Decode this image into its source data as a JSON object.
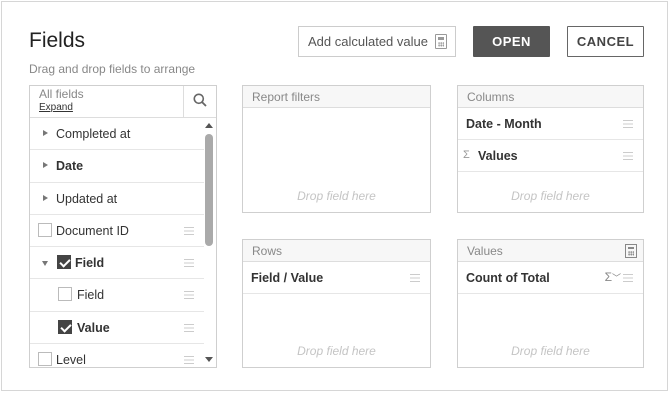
{
  "dialog": {
    "title": "Fields",
    "subtitle": "Drag and drop fields to arrange",
    "add_calculated_label": "Add calculated value",
    "open_label": "OPEN",
    "cancel_label": "CANCEL"
  },
  "all_fields": {
    "header": "All fields",
    "expand_label": "Expand",
    "items": [
      {
        "label": "Completed at",
        "control": "expand-arrow",
        "checked": false
      },
      {
        "label": "Date",
        "control": "expand-arrow",
        "checked": false
      },
      {
        "label": "Updated at",
        "control": "expand-arrow",
        "checked": false
      },
      {
        "label": "Document ID",
        "control": "checkbox",
        "checked": false
      },
      {
        "label": "Field",
        "control": "checkbox",
        "checked": true,
        "expanded": true
      },
      {
        "label": "Field",
        "control": "checkbox",
        "checked": false,
        "child": true
      },
      {
        "label": "Value",
        "control": "checkbox",
        "checked": true,
        "child": true
      },
      {
        "label": "Level",
        "control": "checkbox",
        "checked": false
      }
    ]
  },
  "zones": {
    "report_filters": {
      "title": "Report filters",
      "drop_hint": "Drop field here",
      "items": []
    },
    "columns": {
      "title": "Columns",
      "drop_hint": "Drop field here",
      "items": [
        "Date - Month",
        "Values"
      ]
    },
    "rows": {
      "title": "Rows",
      "drop_hint": "Drop field here",
      "items": [
        "Field / Value"
      ]
    },
    "values": {
      "title": "Values",
      "drop_hint": "Drop field here",
      "items": [
        "Count of Total"
      ],
      "aggregation_symbol": "Σ"
    }
  },
  "colors": {
    "primary_button": "#555555",
    "checkbox_checked": "#444444"
  }
}
